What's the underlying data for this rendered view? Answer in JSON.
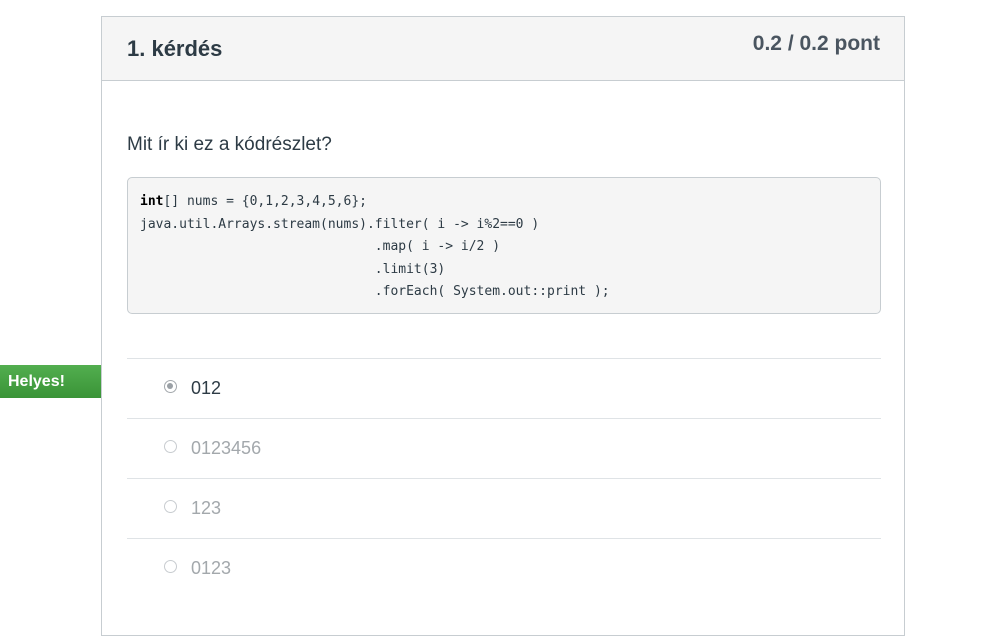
{
  "question": {
    "title": "1. kérdés",
    "points": "0.2 / 0.2 pont",
    "text": "Mit ír ki ez a kódrészlet?",
    "code": {
      "line1_keyword": "int",
      "line1_rest": "[] nums = {0,1,2,3,4,5,6};",
      "line2": "java.util.Arrays.stream(nums).filter( i -> i%2==0 )",
      "line3": "                              .map( i -> i/2 )",
      "line4": "                              .limit(3)",
      "line5": "                              .forEach( System.out::print );"
    }
  },
  "correct_flag": {
    "label": "Helyes!",
    "color": "#43a047"
  },
  "answers": [
    {
      "label": "012",
      "selected": true
    },
    {
      "label": "0123456",
      "selected": false
    },
    {
      "label": "123",
      "selected": false
    },
    {
      "label": "0123",
      "selected": false
    }
  ]
}
